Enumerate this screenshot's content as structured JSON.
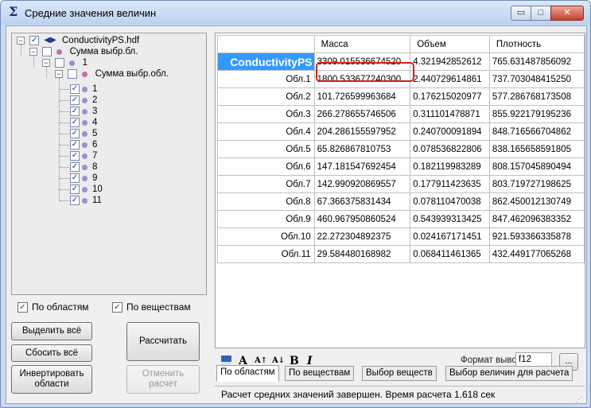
{
  "window": {
    "title": "Средние значения величин",
    "app_icon": "Σ",
    "min_symbol": "▭",
    "max_symbol": "□",
    "close_symbol": "✕"
  },
  "tree": {
    "root": "ConductivityPS.hdf",
    "group1": "Сумма выбр.бл.",
    "block1": "1",
    "group2": "Сумма выбр.обл.",
    "items": [
      "1",
      "2",
      "3",
      "4",
      "5",
      "6",
      "7",
      "8",
      "9",
      "10",
      "11"
    ]
  },
  "options": {
    "by_regions": "По областям",
    "by_substances": "По веществам"
  },
  "buttons": {
    "select_all": "Выделить всё",
    "reset_all": "Сбосить всё",
    "invert_regions": "Инвертировать области",
    "calculate": "Рассчитать",
    "cancel_calc": "Отменить расчет"
  },
  "table": {
    "columns": [
      "Масса",
      "Объем",
      "Плотность"
    ],
    "rows": [
      {
        "label": "ConductivityPS",
        "mass": "3309.015536674520",
        "volume": "4.321942852612",
        "density": "765.631487856092"
      },
      {
        "label": "Обл.1",
        "mass": "1800.533677240300",
        "volume": "2.440729614861",
        "density": "737.703048415250"
      },
      {
        "label": "Обл.2",
        "mass": "101.726599963684",
        "volume": "0.176215020977",
        "density": "577.286768173508"
      },
      {
        "label": "Обл.3",
        "mass": "266.278655746506",
        "volume": "0.311101478871",
        "density": "855.922179195236"
      },
      {
        "label": "Обл.4",
        "mass": "204.286155597952",
        "volume": "0.240700091894",
        "density": "848.716566704862"
      },
      {
        "label": "Обл.5",
        "mass": "65.826867810753",
        "volume": "0.078536822806",
        "density": "838.165658591805"
      },
      {
        "label": "Обл.6",
        "mass": "147.181547692454",
        "volume": "0.182119983289",
        "density": "808.157045890494"
      },
      {
        "label": "Обл.7",
        "mass": "142.990920869557",
        "volume": "0.177911423635",
        "density": "803.719727198625"
      },
      {
        "label": "Обл.8",
        "mass": "67.366375831434",
        "volume": "0.078110470038",
        "density": "862.450012130749"
      },
      {
        "label": "Обл.9",
        "mass": "460.967950860524",
        "volume": "0.543939313425",
        "density": "847.462096383352"
      },
      {
        "label": "Обл.10",
        "mass": "22.272304892375",
        "volume": "0.024167171451",
        "density": "921.593366335878"
      },
      {
        "label": "Обл.11",
        "mass": "29.584480168982",
        "volume": "0.068411461365",
        "density": "432.449177065268"
      }
    ]
  },
  "toolbar": {
    "font_a": "A",
    "grow": "A↑",
    "sort": "A↓",
    "bold": "B",
    "italic": "I",
    "format_label": "Формат вывода:",
    "format_value": "f12",
    "more": "..."
  },
  "tabs": [
    "По областям",
    "По веществам",
    "Выбор веществ",
    "Выбор величин для расчета"
  ],
  "status": {
    "text": "Расчет средних значений завершен. Время расчета 1.618 сек",
    "grip": "⋰"
  }
}
